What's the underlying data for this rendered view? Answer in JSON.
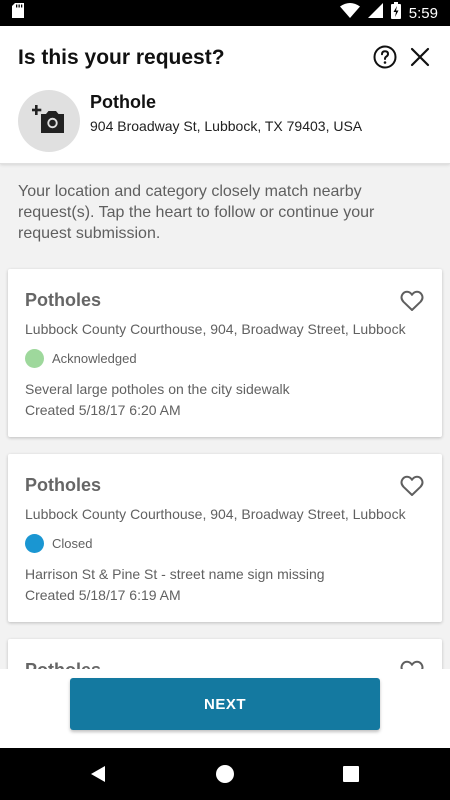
{
  "status_bar": {
    "time": "5:59",
    "icons": [
      "sd-card-icon",
      "wifi-icon",
      "signal-icon",
      "battery-icon"
    ]
  },
  "header": {
    "title": "Is this your request?",
    "help_icon": "help-circle-icon",
    "close_icon": "close-icon"
  },
  "request": {
    "photo_icon": "add-photo-icon",
    "category": "Pothole",
    "address": "904 Broadway St, Lubbock, TX 79403, USA"
  },
  "intro_text": "Your location and category closely match nearby request(s). Tap the heart to follow or continue your request submission.",
  "cards": [
    {
      "title": "Potholes",
      "location": "Lubbock County Courthouse, 904, Broadway Street, Lubbock",
      "status": "Acknowledged",
      "status_color": "#9ed89c",
      "description": "Several large potholes on the city sidewalk",
      "created": "Created 5/18/17 6:20 AM"
    },
    {
      "title": "Potholes",
      "location": "Lubbock County Courthouse, 904, Broadway Street, Lubbock",
      "status": "Closed",
      "status_color": "#1a96d2",
      "description": "Harrison St & Pine St - street name sign missing",
      "created": "Created 5/18/17 6:19 AM"
    },
    {
      "title": "Potholes",
      "location": "",
      "status": "",
      "status_color": "#ffffff",
      "description": "",
      "created": ""
    }
  ],
  "footer": {
    "next_label": "NEXT",
    "accent": "#1479a0"
  },
  "nav_bar": {
    "icons": [
      "back-icon",
      "home-icon",
      "recents-icon"
    ]
  }
}
